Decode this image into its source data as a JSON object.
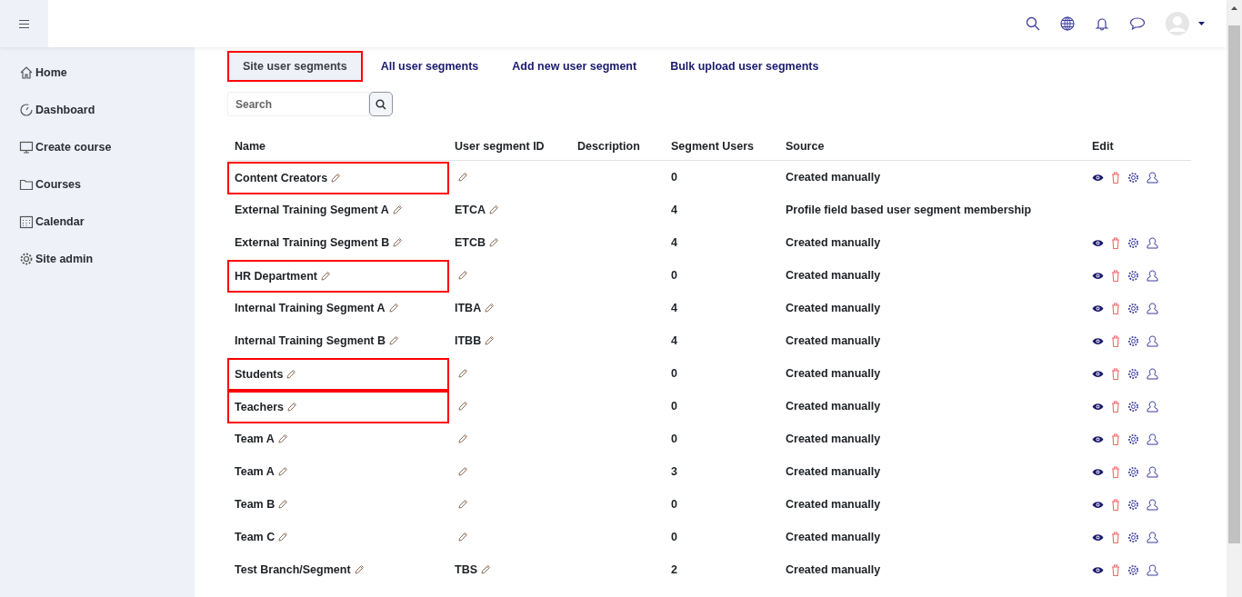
{
  "sidebar": {
    "items": [
      {
        "label": "Home",
        "kind": "home"
      },
      {
        "label": "Dashboard",
        "kind": "dashboard"
      },
      {
        "label": "Create course",
        "kind": "monitor"
      },
      {
        "label": "Courses",
        "kind": "folder"
      },
      {
        "label": "Calendar",
        "kind": "calendar"
      },
      {
        "label": "Site admin",
        "kind": "gear"
      }
    ]
  },
  "tabs": [
    {
      "label": "Site user segments",
      "selected": true,
      "highlighted": true
    },
    {
      "label": "All user segments",
      "selected": false,
      "highlighted": false
    },
    {
      "label": "Add new user segment",
      "selected": false,
      "highlighted": false
    },
    {
      "label": "Bulk upload user segments",
      "selected": false,
      "highlighted": false
    }
  ],
  "search": {
    "placeholder": "Search"
  },
  "table": {
    "columns": [
      "Name",
      "User segment ID",
      "Description",
      "Segment Users",
      "Source",
      "Edit"
    ],
    "rows": [
      {
        "name": "Content Creators",
        "segment_id": "",
        "users": "0",
        "source": "Created manually",
        "actions": true,
        "highlighted": true
      },
      {
        "name": "External Training Segment A",
        "segment_id": "ETCA",
        "users": "4",
        "source": "Profile field based user segment membership",
        "actions": false,
        "highlighted": false
      },
      {
        "name": "External Training Segment B",
        "segment_id": "ETCB",
        "users": "4",
        "source": "Created manually",
        "actions": true,
        "highlighted": false
      },
      {
        "name": "HR Department",
        "segment_id": "",
        "users": "0",
        "source": "Created manually",
        "actions": true,
        "highlighted": true
      },
      {
        "name": "Internal Training Segment A",
        "segment_id": "ITBA",
        "users": "4",
        "source": "Created manually",
        "actions": true,
        "highlighted": false
      },
      {
        "name": "Internal Training Segment B",
        "segment_id": "ITBB",
        "users": "4",
        "source": "Created manually",
        "actions": true,
        "highlighted": false
      },
      {
        "name": "Students",
        "segment_id": "",
        "users": "0",
        "source": "Created manually",
        "actions": true,
        "highlighted": true
      },
      {
        "name": "Teachers",
        "segment_id": "",
        "users": "0",
        "source": "Created manually",
        "actions": true,
        "highlighted": true
      },
      {
        "name": "Team A",
        "segment_id": "",
        "users": "0",
        "source": "Created manually",
        "actions": true,
        "highlighted": false
      },
      {
        "name": "Team A",
        "segment_id": "",
        "users": "3",
        "source": "Created manually",
        "actions": true,
        "highlighted": false
      },
      {
        "name": "Team B",
        "segment_id": "",
        "users": "0",
        "source": "Created manually",
        "actions": true,
        "highlighted": false
      },
      {
        "name": "Team C",
        "segment_id": "",
        "users": "0",
        "source": "Created manually",
        "actions": true,
        "highlighted": false
      },
      {
        "name": "Test Branch/Segment",
        "segment_id": "TBS",
        "users": "2",
        "source": "Created manually",
        "actions": true,
        "highlighted": false
      }
    ]
  }
}
